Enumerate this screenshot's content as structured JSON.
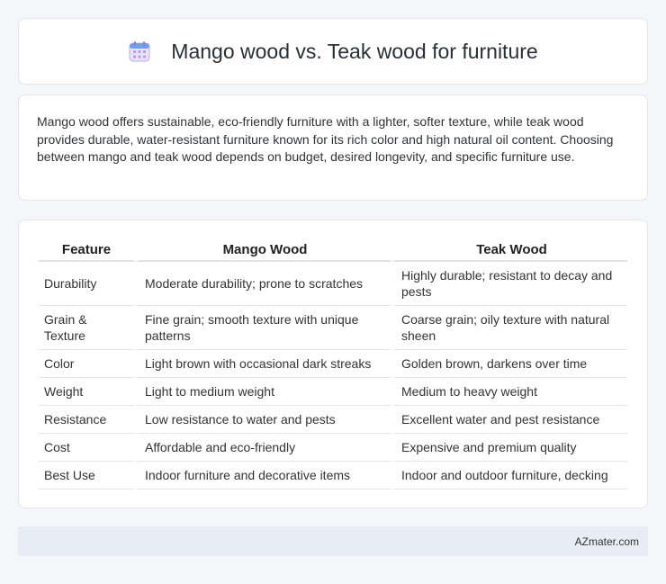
{
  "header": {
    "icon": "calendar-icon",
    "title": "Mango wood vs. Teak wood for furniture"
  },
  "intro": {
    "text": "Mango wood offers sustainable, eco-friendly furniture with a lighter, softer texture, while teak wood provides durable, water-resistant furniture known for its rich color and high natural oil content. Choosing between mango and teak wood depends on budget, desired longevity, and specific furniture use."
  },
  "table": {
    "headers": [
      "Feature",
      "Mango Wood",
      "Teak Wood"
    ],
    "rows": [
      [
        "Durability",
        "Moderate durability; prone to scratches",
        "Highly durable; resistant to decay and pests"
      ],
      [
        "Grain & Texture",
        "Fine grain; smooth texture with unique patterns",
        "Coarse grain; oily texture with natural sheen"
      ],
      [
        "Color",
        "Light brown with occasional dark streaks",
        "Golden brown, darkens over time"
      ],
      [
        "Weight",
        "Light to medium weight",
        "Medium to heavy weight"
      ],
      [
        "Resistance",
        "Low resistance to water and pests",
        "Excellent water and pest resistance"
      ],
      [
        "Cost",
        "Affordable and eco-friendly",
        "Expensive and premium quality"
      ],
      [
        "Best Use",
        "Indoor furniture and decorative items",
        "Indoor and outdoor furniture, decking"
      ]
    ]
  },
  "footer": {
    "brand": "AZmater.com"
  }
}
